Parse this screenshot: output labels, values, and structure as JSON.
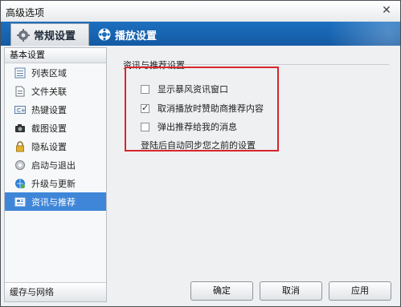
{
  "window": {
    "title": "高级选项",
    "close_glyph": "✕"
  },
  "tabs": [
    {
      "label": "常规设置",
      "icon": "gear-icon",
      "active": true
    },
    {
      "label": "播放设置",
      "icon": "play-settings-icon",
      "active": false
    }
  ],
  "sidebar": {
    "header": "基本设置",
    "items": [
      {
        "label": "列表区域",
        "icon": "list-icon"
      },
      {
        "label": "文件关联",
        "icon": "file-icon"
      },
      {
        "label": "热键设置",
        "icon": "keyboard-icon"
      },
      {
        "label": "截图设置",
        "icon": "camera-icon"
      },
      {
        "label": "隐私设置",
        "icon": "lock-icon"
      },
      {
        "label": "启动与退出",
        "icon": "power-gear-icon"
      },
      {
        "label": "升级与更新",
        "icon": "globe-update-icon"
      },
      {
        "label": "资讯与推荐",
        "icon": "news-icon",
        "selected": true
      }
    ],
    "footer": "缓存与网络"
  },
  "content": {
    "section_title": "资讯与推荐设置",
    "options": [
      {
        "label": "显示暴风资讯窗口",
        "checked": false
      },
      {
        "label": "取消播放时赞助商推荐内容",
        "checked": true
      },
      {
        "label": "弹出推荐给我的消息",
        "checked": false
      }
    ],
    "note": "登陆后自动同步您之前的设置"
  },
  "buttons": {
    "ok": "确定",
    "cancel": "取消",
    "apply": "应用"
  },
  "colors": {
    "tabbar": "#1c6fbf",
    "selected": "#3f86d8",
    "highlight": "#d8262c"
  }
}
